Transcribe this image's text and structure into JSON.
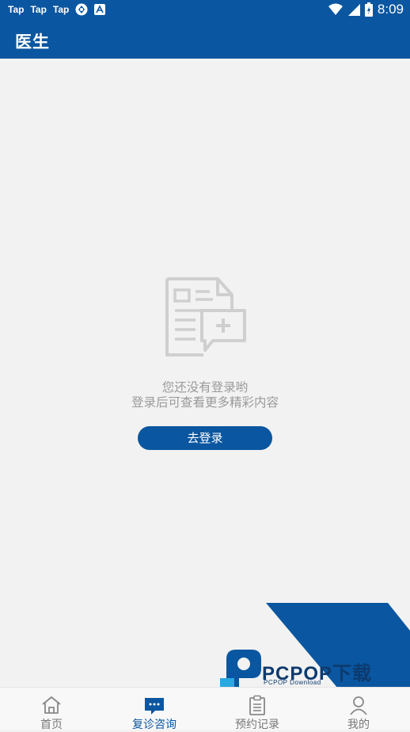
{
  "status_bar": {
    "notif_labels": [
      "Tap",
      "Tap",
      "Tap"
    ],
    "time": "8:09",
    "icons": [
      "sync-icon",
      "app-store-icon",
      "wifi-icon",
      "cell-signal-icon",
      "battery-icon"
    ]
  },
  "header": {
    "title": "医生"
  },
  "empty_state": {
    "line1": "您还没有登录哟",
    "line2": "登录后可查看更多精彩内容",
    "login_label": "去登录"
  },
  "watermark": {
    "brand": "PCPOP下载",
    "sub": "PCPOP Download"
  },
  "tabs": [
    {
      "label": "首页",
      "icon": "home-icon"
    },
    {
      "label": "复诊咨询",
      "icon": "chat-icon",
      "active": true
    },
    {
      "label": "预约记录",
      "icon": "clipboard-icon"
    },
    {
      "label": "我的",
      "icon": "user-icon"
    }
  ],
  "colors": {
    "primary": "#0a56a0",
    "background": "#f2f2f2",
    "muted_text": "#9a9a9a"
  }
}
